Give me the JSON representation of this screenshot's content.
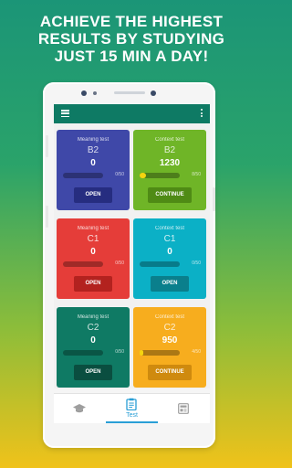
{
  "promo": {
    "line1": "ACHIEVE THE HIGHEST",
    "line2": "RESULTS BY STUDYING",
    "line3": "JUST 15 MIN A DAY!"
  },
  "colors": {
    "appbar": "#0e7a64",
    "accent": "#2a9fd6",
    "progress_fill": "#f5d40f"
  },
  "cards": [
    {
      "type": "Meaning test",
      "level": "B2",
      "score": "0",
      "count": "0/50",
      "progress": 0,
      "button": "OPEN",
      "bg": "#3f48a8",
      "btn_bg": "#262d80"
    },
    {
      "type": "Context test",
      "level": "B2",
      "score": "1230",
      "count": "8/50",
      "progress": 0.16,
      "button": "CONTINUE",
      "bg": "#6fb527",
      "btn_bg": "#4f8b15"
    },
    {
      "type": "Meaning test",
      "level": "C1",
      "score": "0",
      "count": "0/50",
      "progress": 0,
      "button": "OPEN",
      "bg": "#e53d39",
      "btn_bg": "#b3221f"
    },
    {
      "type": "Context test",
      "level": "C1",
      "score": "0",
      "count": "0/50",
      "progress": 0,
      "button": "OPEN",
      "bg": "#0bb0c6",
      "btn_bg": "#0a7f8c"
    },
    {
      "type": "Meaning test",
      "level": "C2",
      "score": "0",
      "count": "0/50",
      "progress": 0,
      "button": "OPEN",
      "bg": "#0f7a64",
      "btn_bg": "#0a4e40"
    },
    {
      "type": "Context test",
      "level": "C2",
      "score": "950",
      "count": "4/50",
      "progress": 0.08,
      "button": "CONTINUE",
      "bg": "#f7ad1e",
      "btn_bg": "#cf8a0e"
    }
  ],
  "nav": {
    "items": [
      {
        "icon": "graduation-cap-icon",
        "label": ""
      },
      {
        "icon": "clipboard-icon",
        "label": "Test"
      },
      {
        "icon": "dictionary-icon",
        "label": ""
      }
    ],
    "active": "Test"
  }
}
